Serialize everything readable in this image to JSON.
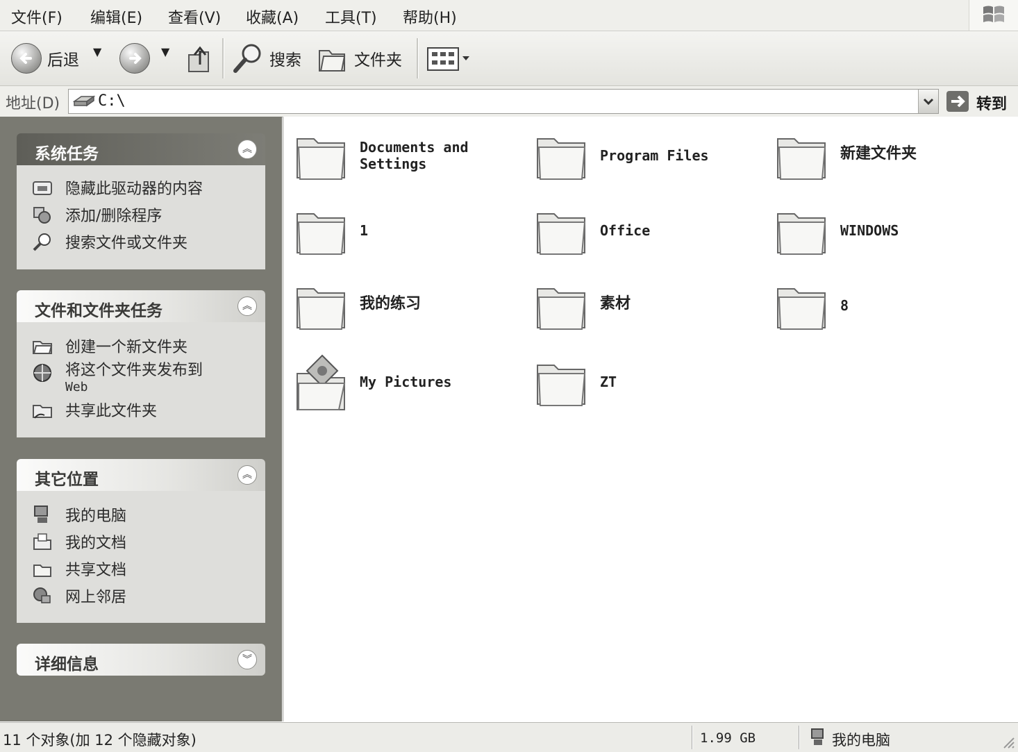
{
  "menu": [
    "文件(F)",
    "编辑(E)",
    "查看(V)",
    "收藏(A)",
    "工具(T)",
    "帮助(H)"
  ],
  "toolbar": {
    "back_label": "后退",
    "search_label": "搜索",
    "folders_label": "文件夹"
  },
  "address": {
    "label": "地址(D)",
    "value": "C:\\",
    "go_label": "转到"
  },
  "panels": {
    "system_tasks": {
      "title": "系统任务",
      "items": [
        "隐藏此驱动器的内容",
        "添加/删除程序",
        "搜索文件或文件夹"
      ]
    },
    "file_folder_tasks": {
      "title": "文件和文件夹任务",
      "items": [
        "创建一个新文件夹",
        "将这个文件夹发布到 Web",
        "共享此文件夹"
      ],
      "publish_line1": "将这个文件夹发布到",
      "publish_line2": "Web"
    },
    "other_places": {
      "title": "其它位置",
      "items": [
        "我的电脑",
        "我的文档",
        "共享文档",
        "网上邻居"
      ]
    },
    "details": {
      "title": "详细信息"
    }
  },
  "folders": [
    {
      "name": "Documents and Settings",
      "line1": "Documents and",
      "line2": "Settings"
    },
    {
      "name": "Program Files"
    },
    {
      "name": "新建文件夹"
    },
    {
      "name": "1"
    },
    {
      "name": "Office"
    },
    {
      "name": "WINDOWS"
    },
    {
      "name": "我的练习"
    },
    {
      "name": "素材"
    },
    {
      "name": "8"
    },
    {
      "name": "My Pictures"
    },
    {
      "name": "ZT"
    }
  ],
  "status": {
    "objects": "11 个对象(加 12 个隐藏对象)",
    "size": "1.99 GB",
    "location": "我的电脑"
  },
  "colors": {
    "pane_background": "#7a7a72",
    "panel_body": "#dededb",
    "content_background": "#ffffff"
  }
}
